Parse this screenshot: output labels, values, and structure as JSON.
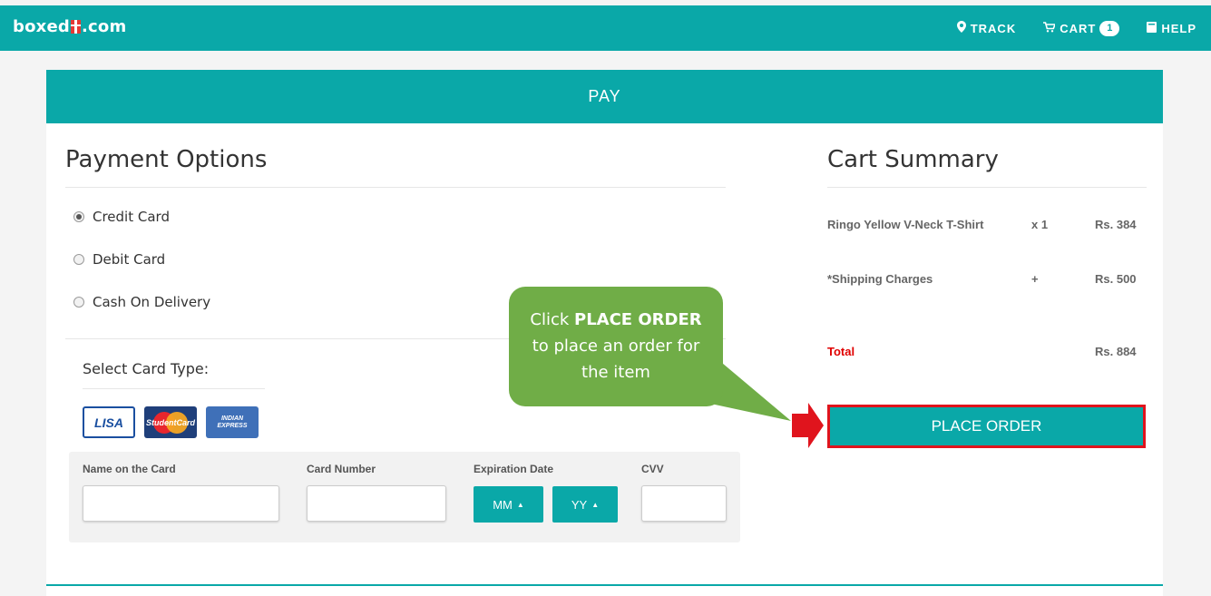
{
  "site": {
    "logo_left": "boxed",
    "logo_right": ".com"
  },
  "nav": {
    "track": "TRACK",
    "cart": "CART",
    "cart_count": "1",
    "help": "HELP"
  },
  "page": {
    "header": "PAY"
  },
  "payment": {
    "title": "Payment Options",
    "options": [
      {
        "label": "Credit Card",
        "checked": true
      },
      {
        "label": "Debit Card",
        "checked": false
      },
      {
        "label": "Cash On Delivery",
        "checked": false
      }
    ],
    "card_type_label": "Select Card Type:",
    "card_logos": {
      "visa": "LISA",
      "master": "StudentCard",
      "indian": "INDIAN EXPRESS"
    },
    "form": {
      "name_label": "Name on the Card",
      "number_label": "Card Number",
      "expiry_label": "Expiration Date",
      "month": "MM",
      "year": "YY",
      "cvv_label": "CVV",
      "name_value": "",
      "number_value": "",
      "cvv_value": ""
    }
  },
  "summary": {
    "title": "Cart Summary",
    "item_name": "Ringo Yellow V-Neck T-Shirt",
    "item_qty": "x 1",
    "item_price": "Rs. 384",
    "shipping_label": "*Shipping Charges",
    "shipping_sign": "+",
    "shipping_price": "Rs. 500",
    "total_label": "Total",
    "total_price": "Rs. 884",
    "place_order": "PLACE ORDER"
  },
  "callout": {
    "line1_prefix": "Click ",
    "line1_bold": "PLACE ORDER",
    "line2": "to place an order for",
    "line3": "the item"
  },
  "colors": {
    "accent": "#0aa8a8",
    "callout": "#70ad47",
    "highlight": "#e0141d",
    "total": "#e00000"
  }
}
